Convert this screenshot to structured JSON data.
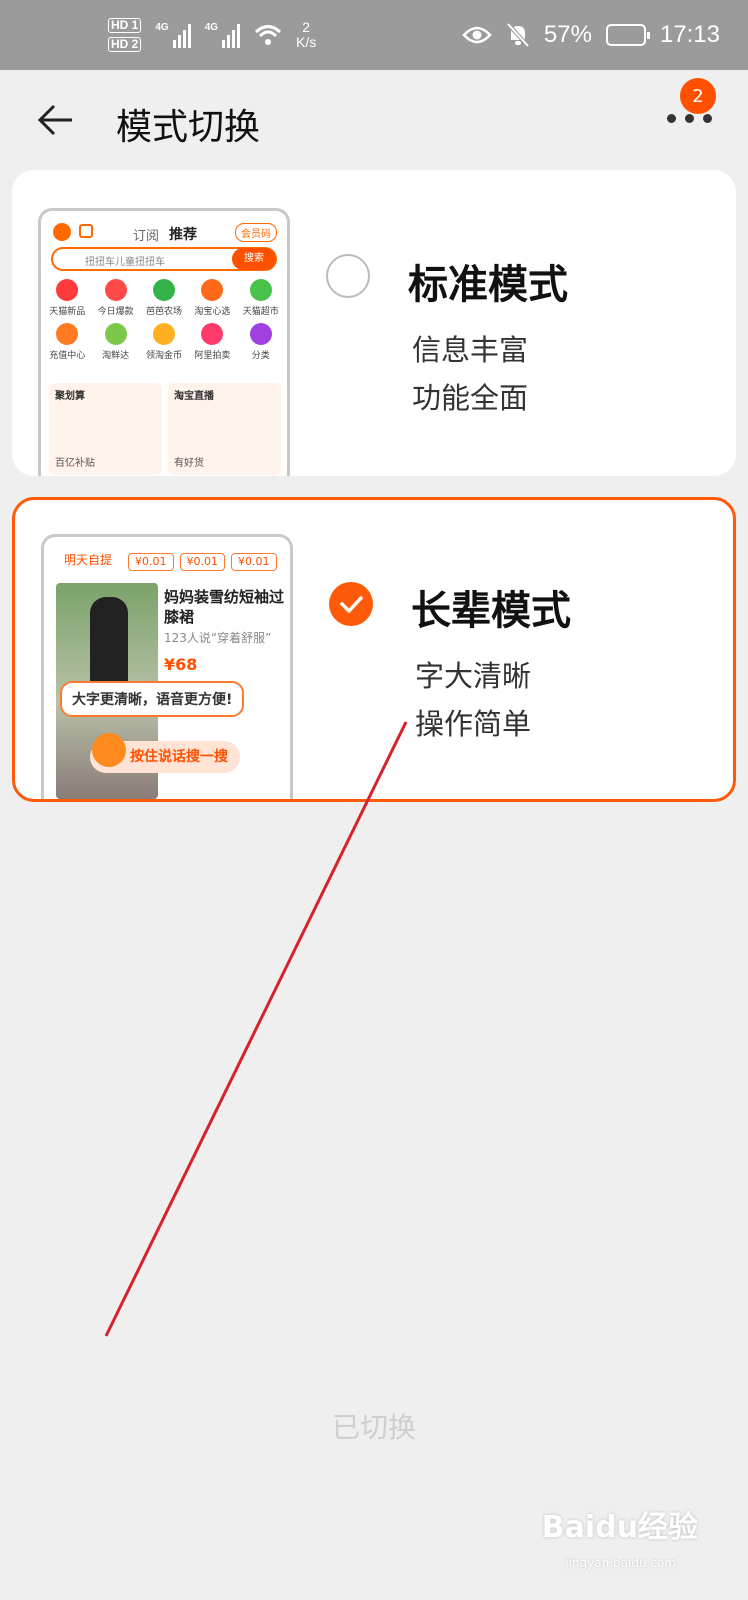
{
  "status_bar": {
    "hd1": "HD 1",
    "hd2": "HD 2",
    "net1": "4G",
    "net2": "4G",
    "speed_value": "2",
    "speed_unit": "K/s",
    "battery": "57%",
    "time": "17:13"
  },
  "header": {
    "title": "模式切换",
    "badge": "2"
  },
  "standard_mode": {
    "name": "标准模式",
    "desc_line1": "信息丰富",
    "desc_line2": "功能全面",
    "selected": false,
    "preview": {
      "tab_sub": "订阅",
      "tab_rec": "推荐",
      "vip": "会员码",
      "search_placeholder": "扭扭车儿童扭扭车",
      "search_btn": "搜索",
      "icons": [
        "天猫新品",
        "今日爆款",
        "芭芭农场",
        "淘宝心选",
        "天猫超市",
        "充值中心",
        "淘鲜达",
        "领淘金币",
        "阿里拍卖",
        "分类"
      ],
      "icon_colors": [
        "#ff3a3a",
        "#ff4a4a",
        "#33b34a",
        "#ff6a1a",
        "#49c24a",
        "#ff7a20",
        "#7cc84a",
        "#ffb020",
        "#ff3a6a",
        "#a040e0"
      ],
      "block1_title": "聚划算",
      "block1_sub": "百亿补贴",
      "block2_title": "淘宝直播",
      "block2_sub": "有好货"
    }
  },
  "elder_mode": {
    "name": "长辈模式",
    "desc_line1": "字大清晰",
    "desc_line2": "操作简单",
    "selected": true,
    "preview": {
      "tag": "明天自提",
      "prices": [
        "¥0.01",
        "¥0.01",
        "¥0.01"
      ],
      "item_title": "妈妈装雪纺短袖过膝裙",
      "item_sub": "123人说“穿着舒服”",
      "item_price": "¥68",
      "bubble": "大字更清晰，语音更方便!",
      "voice_btn": "按住说话搜一搜"
    }
  },
  "footer": {
    "status": "已切换"
  },
  "watermark": {
    "brand": "Baidu经验",
    "site": "jingyan.baidu.com"
  },
  "colors": {
    "accent": "#ff5a0a",
    "annotation_line": "#d6222c"
  }
}
